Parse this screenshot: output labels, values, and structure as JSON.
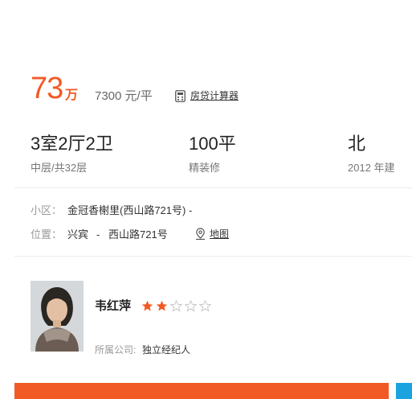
{
  "price": {
    "amount": "73",
    "unit": "万",
    "unit_price": "7300 元/平",
    "calculator_label": "房贷计算器"
  },
  "facts": [
    {
      "main": "3室2厅2卫",
      "sub": "中层/共32层"
    },
    {
      "main": "100平",
      "sub": "精装修"
    },
    {
      "main": "北",
      "sub": "2012 年建"
    }
  ],
  "community": {
    "label": "小区：",
    "value": "金冠香榭里(西山路721号) -"
  },
  "location": {
    "label": "位置：",
    "district": "兴宾",
    "separator": "-",
    "street": "西山路721号",
    "map_label": "地图"
  },
  "agent": {
    "name": "韦红萍",
    "rating": 2,
    "rating_max": 5,
    "company_label": "所属公司:",
    "company": "独立经纪人"
  },
  "colors": {
    "accent": "#f15a24",
    "blue": "#1aa3df",
    "star_on": "#f15a24",
    "star_off": "#c8c8c8"
  }
}
